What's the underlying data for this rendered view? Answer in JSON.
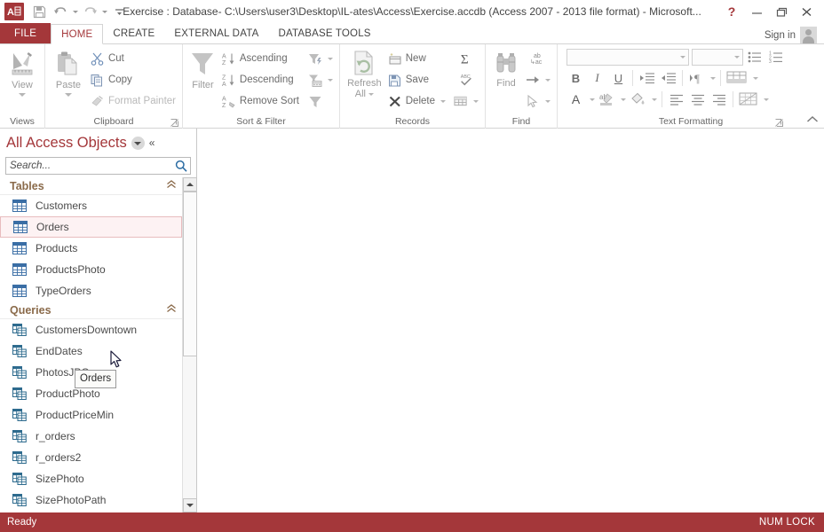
{
  "window": {
    "title": "Exercise : Database- C:\\Users\\user3\\Desktop\\IL-ates\\Access\\Exercise.accdb (Access 2007 - 2013 file format) - Microsoft...",
    "app_icon_label": "A",
    "quick_access": [
      {
        "name": "save-icon",
        "label": "Save"
      },
      {
        "name": "undo-icon",
        "label": "Undo"
      },
      {
        "name": "redo-icon",
        "label": "Redo"
      },
      {
        "name": "customize-qat-icon",
        "label": "Customize Quick Access Toolbar"
      }
    ],
    "controls": {
      "help": "?",
      "minimize": "—",
      "restore": "❐",
      "close": "✕"
    },
    "sign_in": "Sign in"
  },
  "tabs": [
    {
      "label": "FILE",
      "active": false,
      "file": true
    },
    {
      "label": "HOME",
      "active": true,
      "file": false
    },
    {
      "label": "CREATE",
      "active": false,
      "file": false
    },
    {
      "label": "EXTERNAL DATA",
      "active": false,
      "file": false
    },
    {
      "label": "DATABASE TOOLS",
      "active": false,
      "file": false
    }
  ],
  "ribbon": {
    "views": {
      "group_label": "Views",
      "view_button": "View"
    },
    "clipboard": {
      "group_label": "Clipboard",
      "paste": "Paste",
      "cut": "Cut",
      "copy": "Copy",
      "format_painter": "Format Painter"
    },
    "sort_filter": {
      "group_label": "Sort & Filter",
      "filter": "Filter",
      "ascending": "Ascending",
      "descending": "Descending",
      "remove_sort": "Remove Sort",
      "advanced": "Advanced",
      "toggle_filter": "Toggle Filter"
    },
    "records": {
      "group_label": "Records",
      "refresh_all": "Refresh",
      "refresh_all2": "All",
      "new": "New",
      "save": "Save",
      "delete": "Delete",
      "totals": "Σ",
      "spelling": "Spelling",
      "more": "More"
    },
    "find": {
      "group_label": "Find",
      "find": "Find",
      "replace": "Replace",
      "go_to": "Go To",
      "select": "Select"
    },
    "text_formatting": {
      "group_label": "Text Formatting",
      "font_name": "",
      "font_size": "",
      "bold": "B",
      "italic": "I",
      "underline": "U",
      "align_left": "Align Left",
      "align_center": "Center",
      "align_right": "Align Right",
      "bullets": "Bulleted List",
      "numbering": "Numbered List",
      "indent_increase": "Increase Indent",
      "indent_decrease": "Decrease Indent",
      "text_direction": "Text Direction",
      "background_color_grid": "Alternate Row Color",
      "font_color": "A",
      "text_highlight": "Text Highlight Color",
      "background_fill": "Background Color",
      "gridlines": "Gridlines"
    },
    "collapse_ribbon": "⌃"
  },
  "nav_pane": {
    "title": "All Access Objects",
    "dropdown_icon": "chevron-down",
    "collapse_icon": "«",
    "search": {
      "placeholder": "Search...",
      "value": ""
    },
    "groups": [
      {
        "label": "Tables",
        "collapse_chevron": "⌃",
        "icon_type": "table",
        "items": [
          {
            "label": "Customers",
            "selected": false
          },
          {
            "label": "Orders",
            "selected": true
          },
          {
            "label": "Products",
            "selected": false
          },
          {
            "label": "ProductsPhoto",
            "selected": false
          },
          {
            "label": "TypeOrders",
            "selected": false
          }
        ]
      },
      {
        "label": "Queries",
        "collapse_chevron": "⌃",
        "icon_type": "query",
        "items": [
          {
            "label": "CustomersDowntown",
            "selected": false
          },
          {
            "label": "EndDates",
            "selected": false
          },
          {
            "label": "PhotosJPG",
            "selected": false
          },
          {
            "label": "ProductPhoto",
            "selected": false
          },
          {
            "label": "ProductPriceMin",
            "selected": false
          },
          {
            "label": "r_orders",
            "selected": false
          },
          {
            "label": "r_orders2",
            "selected": false
          },
          {
            "label": "SizePhoto",
            "selected": false
          },
          {
            "label": "SizePhotoPath",
            "selected": false
          }
        ]
      }
    ],
    "scrollbar": {
      "up": "▲",
      "down": "▼"
    }
  },
  "tooltip": {
    "text": "Orders"
  },
  "status_bar": {
    "left": "Ready",
    "right": "NUM LOCK"
  },
  "colors": {
    "accent": "#a4373a",
    "nav_title": "#a4373a",
    "group_header": "#8a6a4a",
    "selection_bg": "#fdf2f3",
    "selection_border": "#e8bcbe",
    "table_icon": "#3a6ea5",
    "query_icon": "#2e6b8e"
  }
}
